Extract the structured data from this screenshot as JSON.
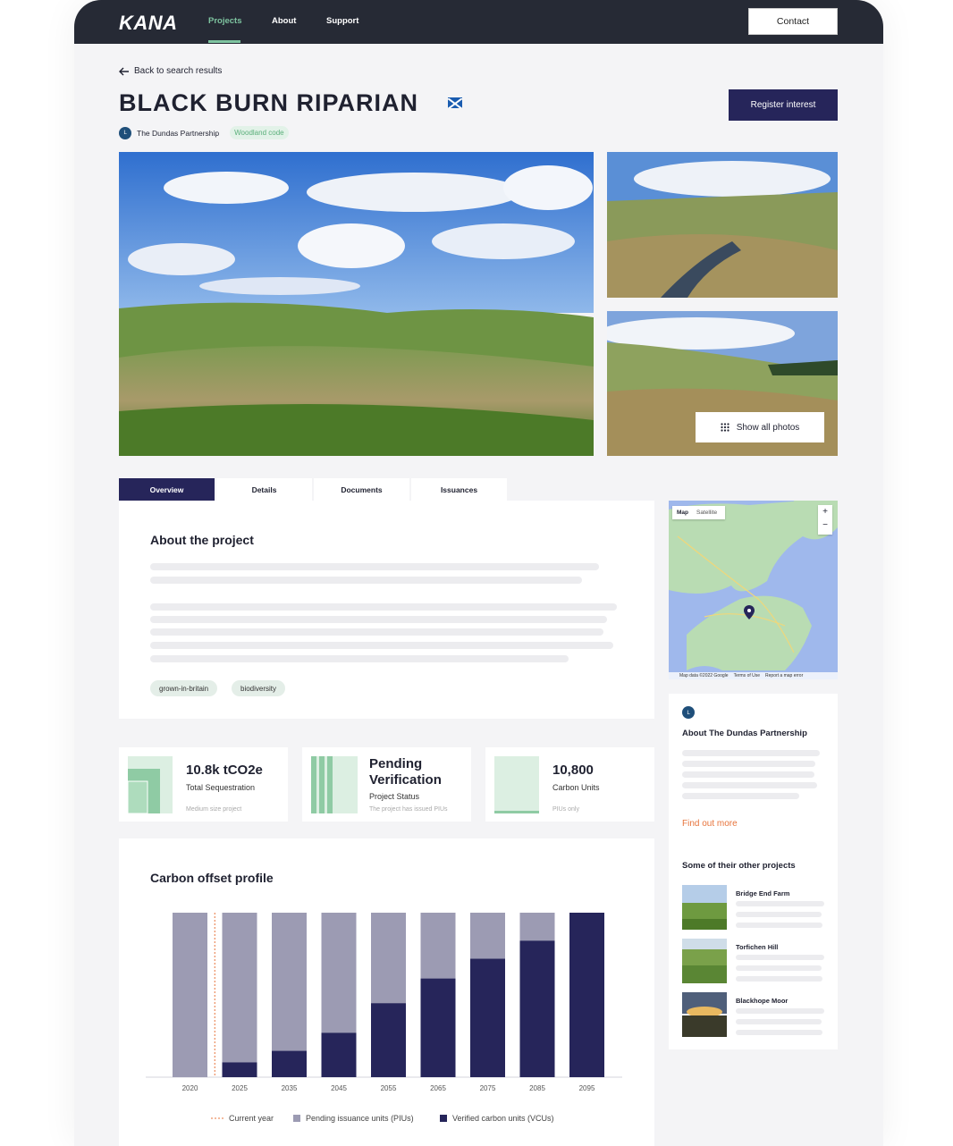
{
  "nav": {
    "logo": "KANA",
    "items": [
      {
        "label": "Projects",
        "active": true
      },
      {
        "label": "About",
        "active": false
      },
      {
        "label": "Support",
        "active": false
      }
    ],
    "contact_label": "Contact"
  },
  "back_label": "Back to search results",
  "project": {
    "title": "BLACK BURN RIPARIAN",
    "register_label": "Register interest",
    "partner": "The Dundas Partnership",
    "badge": "Woodland code"
  },
  "gallery": {
    "show_all_label": "Show all photos"
  },
  "tabs": [
    "Overview",
    "Details",
    "Documents",
    "Issuances"
  ],
  "about": {
    "heading": "About the project",
    "tags": [
      "grown-in-britain",
      "biodiversity"
    ]
  },
  "stats": [
    {
      "value": "10.8k tCO2e",
      "label": "Total Sequestration",
      "note": "Medium size project"
    },
    {
      "value": "Pending Verification",
      "label": "Project Status",
      "note": "The project has issued PIUs"
    },
    {
      "value": "10,800",
      "label": "Carbon Units",
      "note": "PIUs only"
    }
  ],
  "map": {
    "map_label": "Map",
    "satellite_label": "Satellite",
    "zoom_in": "+",
    "zoom_out": "−",
    "attribution": "Map data ©2022 Google",
    "terms": "Terms of Use",
    "report": "Report a map error"
  },
  "sidebar": {
    "about_heading": "About The Dundas Partnership",
    "find_out_more": "Find out more",
    "other_heading": "Some of their other projects",
    "other_projects": [
      "Bridge End Farm",
      "Torfichen Hill",
      "Blackhope Moor"
    ]
  },
  "chart_data": {
    "type": "bar",
    "title": "Carbon offset profile",
    "categories": [
      "2020",
      "2025",
      "2035",
      "2045",
      "2055",
      "2065",
      "2075",
      "2085",
      "2095"
    ],
    "series": [
      {
        "name": "Verified carbon units (VCUs)",
        "color": "#26255a",
        "values": [
          0,
          9,
          16,
          27,
          45,
          60,
          72,
          83,
          100
        ]
      },
      {
        "name": "Pending issuance units (PIUs)",
        "color": "#9c9bb3",
        "values": [
          100,
          91,
          84,
          73,
          55,
          40,
          28,
          17,
          0
        ]
      }
    ],
    "stacked": true,
    "ylim": [
      0,
      100
    ],
    "current_year_label": "Current year",
    "current_year_position": "between 2020 and 2025",
    "legend_position": "bottom"
  }
}
